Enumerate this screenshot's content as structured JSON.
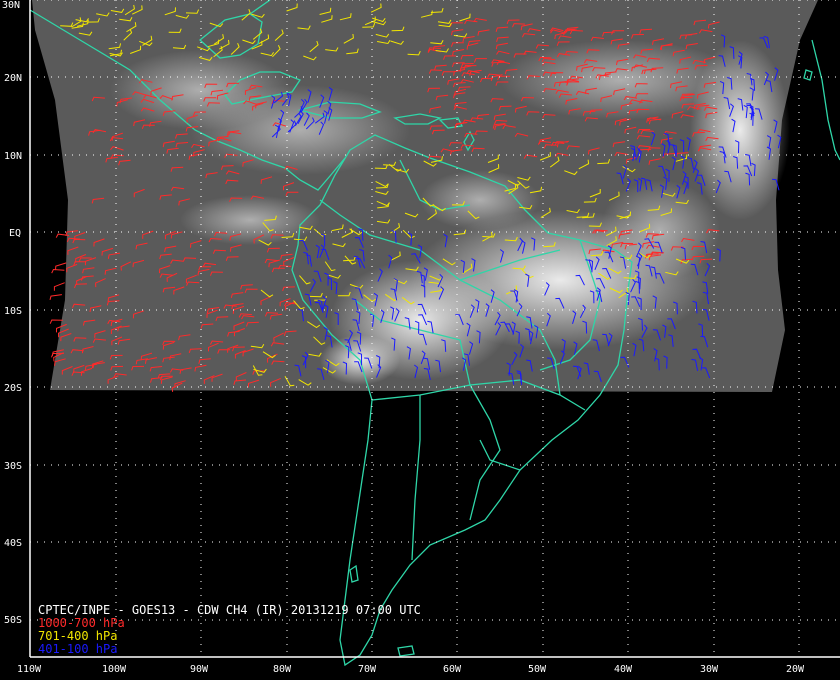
{
  "caption": "CPTEC/INPE - GOES13 - CDW CH4 (IR) 20131219 07:00 UTC",
  "legend": [
    {
      "label": "1000-700 hPa",
      "color": "#ff2a2a"
    },
    {
      "label": "701-400 hPa",
      "color": "#f2e600"
    },
    {
      "label": "401-100 hPa",
      "color": "#1a1aff"
    }
  ],
  "lat_labels": [
    "30N",
    "20N",
    "10N",
    "EQ",
    "10S",
    "20S",
    "30S",
    "40S",
    "50S"
  ],
  "lon_labels": [
    "110W",
    "100W",
    "90W",
    "80W",
    "70W",
    "60W",
    "50W",
    "40W",
    "30W",
    "20W"
  ],
  "colors": {
    "coast": "#2fd6a8",
    "grid": "#ffffff",
    "satellite": "#5a5a5a",
    "background": "#000000"
  }
}
